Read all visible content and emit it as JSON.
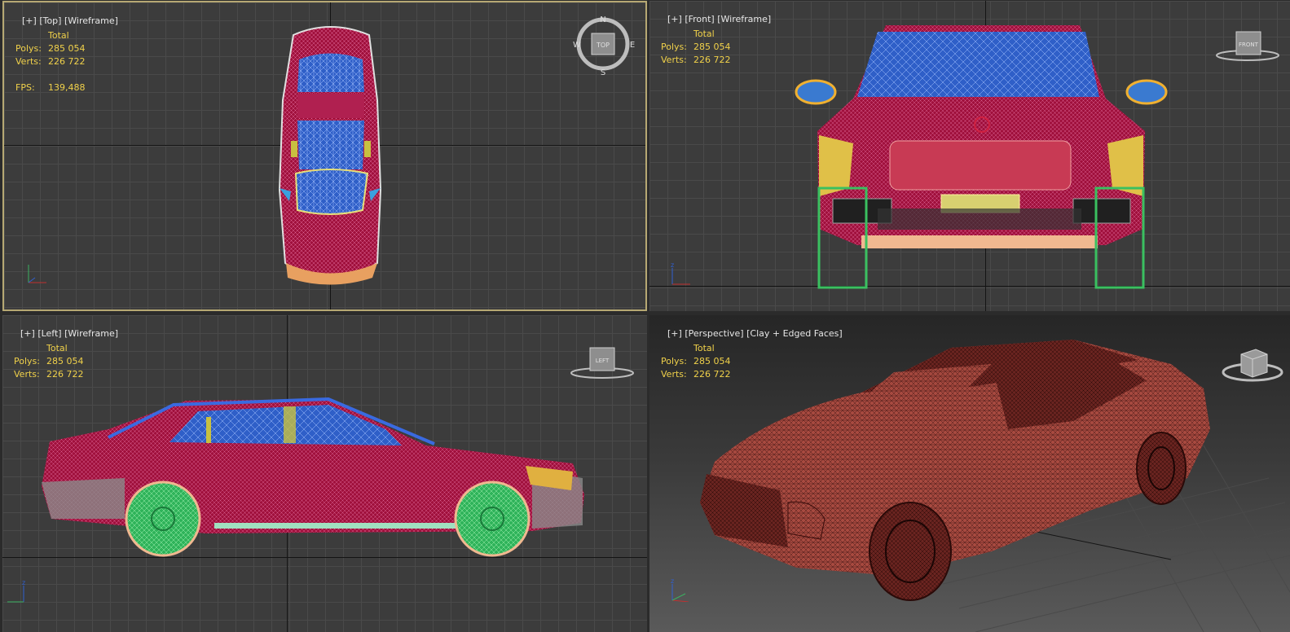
{
  "viewports": {
    "top": {
      "label_plus": "[+]",
      "label_view": "[Top]",
      "label_mode": "[Wireframe]",
      "stats": {
        "total": "Total",
        "polys_label": "Polys:",
        "polys": "285 054",
        "verts_label": "Verts:",
        "verts": "226 722",
        "fps_label": "FPS:",
        "fps": "139,488"
      },
      "compass": {
        "n": "N",
        "s": "S",
        "e": "E",
        "w": "W",
        "cube": "TOP"
      }
    },
    "front": {
      "label_plus": "[+]",
      "label_view": "[Front]",
      "label_mode": "[Wireframe]",
      "stats": {
        "total": "Total",
        "polys_label": "Polys:",
        "polys": "285 054",
        "verts_label": "Verts:",
        "verts": "226 722"
      },
      "cube": "FRONT"
    },
    "left": {
      "label_plus": "[+]",
      "label_view": "[Left]",
      "label_mode": "[Wireframe]",
      "stats": {
        "total": "Total",
        "polys_label": "Polys:",
        "polys": "285 054",
        "verts_label": "Verts:",
        "verts": "226 722"
      },
      "cube": "LEFT"
    },
    "perspective": {
      "label_plus": "[+]",
      "label_view": "[Perspective]",
      "label_mode": "[Clay + Edged Faces]",
      "stats": {
        "total": "Total",
        "polys_label": "Polys:",
        "polys": "285 054",
        "verts_label": "Verts:",
        "verts": "226 722"
      }
    }
  },
  "colors": {
    "body": "#a0103c",
    "glass": "#2f5fc8",
    "wheel": "#2fb35a",
    "trim": "#8a8a8a",
    "clay": "#a84a40",
    "stats": "#f0d14a",
    "active_border": "#b6a873"
  },
  "axis_letters": {
    "z": "z"
  }
}
